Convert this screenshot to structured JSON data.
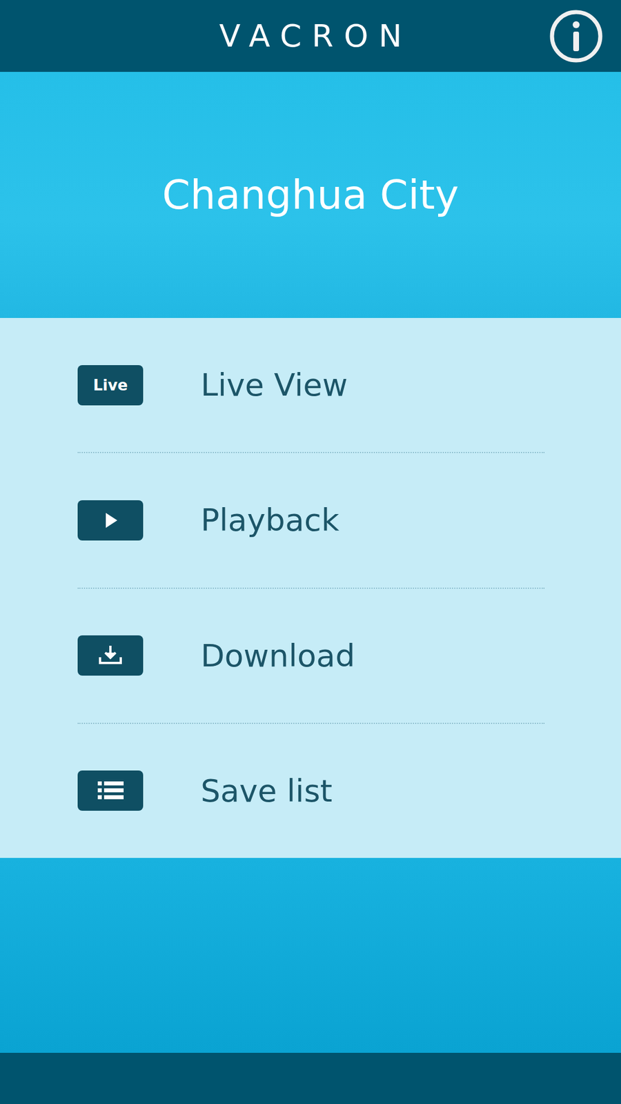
{
  "header": {
    "logo": "VACRON"
  },
  "hero": {
    "title": "Changhua City"
  },
  "menu": [
    {
      "label": "Live View",
      "kind": "live",
      "badge": "Live"
    },
    {
      "label": "Playback",
      "kind": "play"
    },
    {
      "label": "Download",
      "kind": "download"
    },
    {
      "label": "Save list",
      "kind": "list"
    }
  ]
}
